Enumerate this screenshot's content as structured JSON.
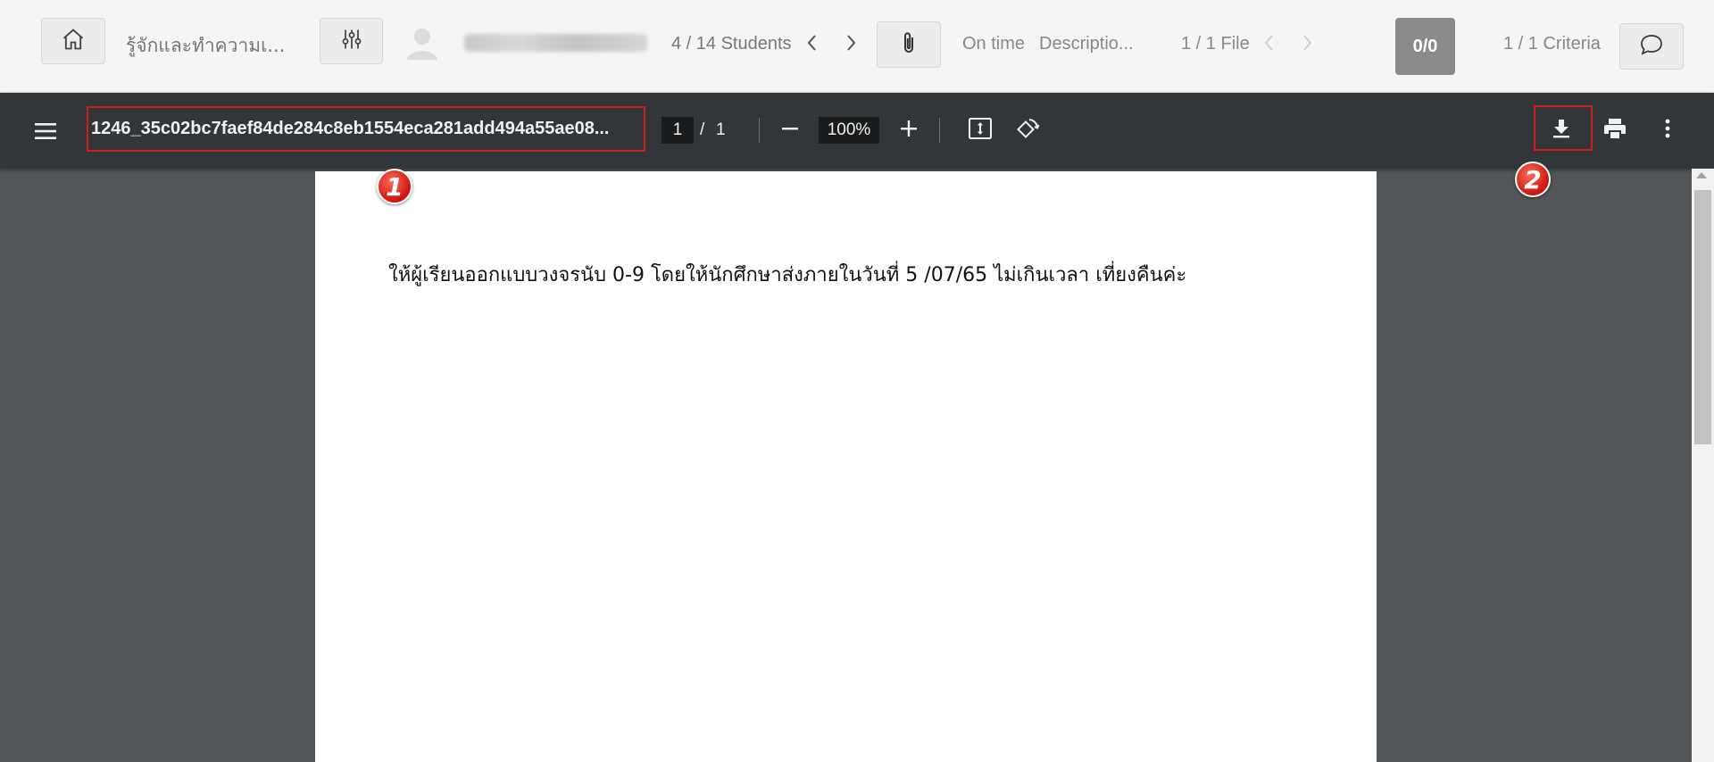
{
  "topbar": {
    "assignment_title": "รู้จักและทำความเ...",
    "students_count": "4 / 14 Students",
    "submission_status": "On time",
    "description": "Descriptio...",
    "files_count": "1 / 1 File",
    "score": "0/0",
    "criteria_count": "1 / 1 Criteria"
  },
  "pdf_toolbar": {
    "filename": "1246_35c02bc7faef84de284c8eb1554eca281add494a55ae08...",
    "current_page": "1",
    "page_separator": "/",
    "total_pages": "1",
    "zoom": "100%"
  },
  "document": {
    "text": "ให้ผู้เรียนออกแบบวงจรนับ 0-9  โดยให้นักศึกษาส่งภายในวันที่ 5 /07/65 ไม่เกินเวลา เที่ยงคืนค่ะ"
  },
  "annotations": {
    "badge_1": "1",
    "badge_2": "2",
    "highlight_color": "#d11c1c"
  },
  "icons": {
    "home": "home-icon",
    "filter": "sliders-icon",
    "attachment": "paperclip-icon",
    "comment": "comment-icon",
    "menu": "hamburger-menu-icon",
    "zoom_out": "minus-icon",
    "zoom_in": "plus-icon",
    "fit_page": "fit-page-icon",
    "rotate": "rotate-icon",
    "download": "download-icon",
    "print": "print-icon",
    "more": "more-vertical-icon"
  }
}
